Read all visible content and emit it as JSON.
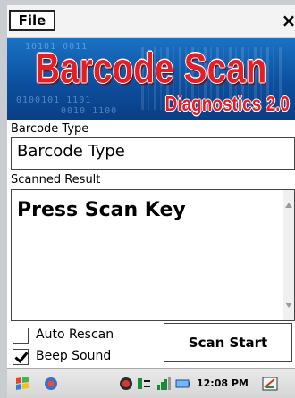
{
  "menubar": {
    "file_label": "File",
    "close_glyph": "×"
  },
  "banner": {
    "title": "Barcode Scan",
    "subtitle": "Diagnostics 2.0",
    "binary_line_1": "0100101 1101",
    "binary_line_2": "0010 1100",
    "binary_line_3": "10101 0011"
  },
  "barcode_type": {
    "label": "Barcode Type",
    "value": "Barcode Type"
  },
  "scanned_result": {
    "label": "Scanned Result",
    "value": "Press Scan Key"
  },
  "options": {
    "auto_rescan": {
      "label": "Auto Rescan",
      "checked": false
    },
    "beep_sound": {
      "label": "Beep Sound",
      "checked": true
    }
  },
  "scan_button": {
    "label": "Scan Start"
  },
  "taskbar": {
    "time": "12:08 PM",
    "icons": [
      "start-flag-icon",
      "app-icon",
      "network-icon",
      "sync-icon",
      "signal-icon",
      "battery-icon",
      "keyboard-icon"
    ]
  },
  "colors": {
    "banner_blue": "#0c4f9e",
    "title_red": "#e31e26"
  }
}
